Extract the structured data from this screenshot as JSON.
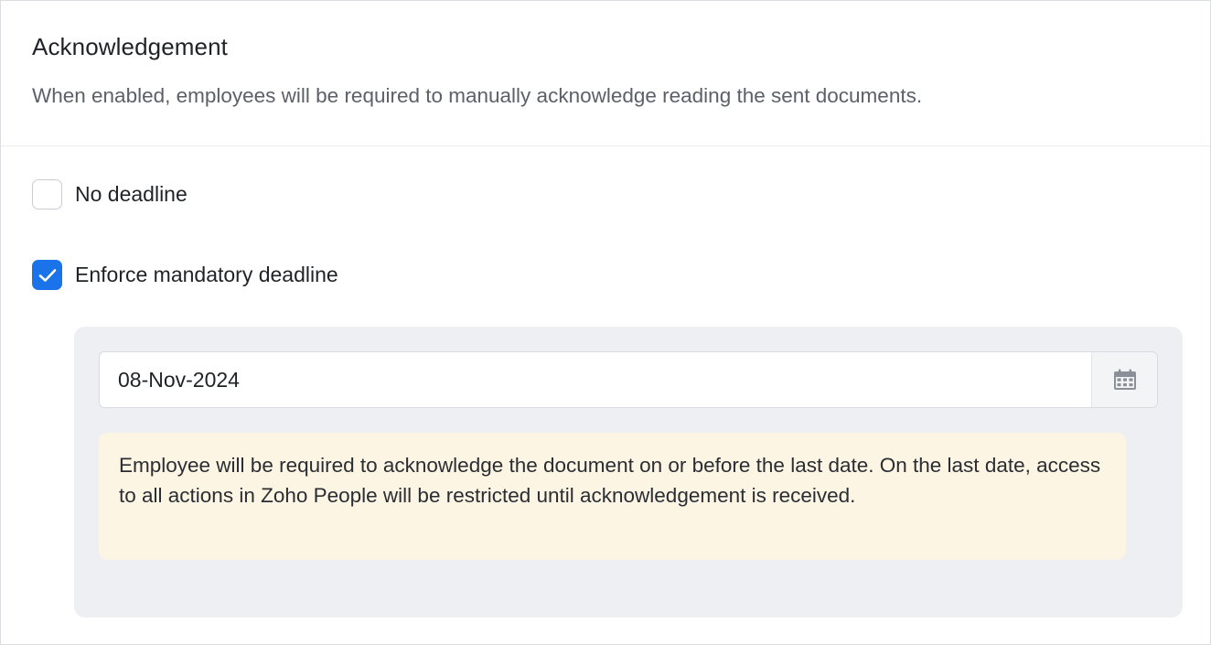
{
  "header": {
    "title": "Acknowledgement",
    "subtitle": "When enabled, employees will be required to manually acknowledge reading the sent documents."
  },
  "options": [
    {
      "label": "No deadline",
      "checked": false
    },
    {
      "label": "Enforce mandatory deadline",
      "checked": true
    }
  ],
  "deadline": {
    "date_value": "08-Nov-2024",
    "calendar_icon": "calendar-icon",
    "note": "Employee will be required to acknowledge the document on or before the last date. On the last date, access to all actions in Zoho People will be restricted until acknowledgement is received."
  },
  "colors": {
    "accent": "#1a73e8",
    "note_background": "#fdf5e4",
    "deadline_background": "#edeff3"
  }
}
